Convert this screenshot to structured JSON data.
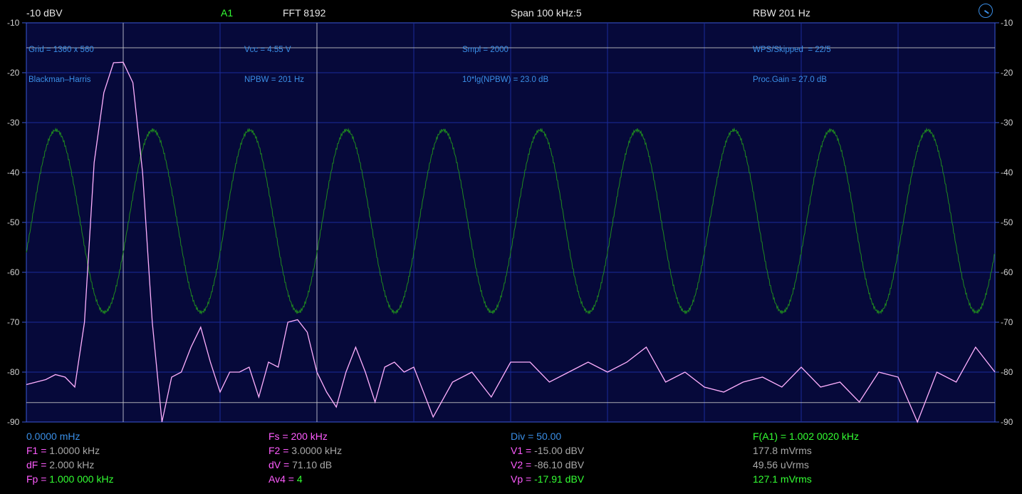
{
  "header": {
    "ref_level": "-10 dBV",
    "channel": "A1",
    "fft": "FFT  8192",
    "span": "Span 100 kHz:5",
    "rbw": "RBW 201 Hz"
  },
  "info": {
    "col1_line1": "Grid = 1360 x 560",
    "col1_line2": "Blackman–Harris",
    "col2_line1": "Vcc = 4.55 V",
    "col2_line2": "NPBW = 201 Hz",
    "col3_line1": "Smpl = 2000",
    "col3_line2": "10*lg(NPBW) = 23.0 dB",
    "col4_line1": "WPS/Skipped  = 22/5",
    "col4_line2": "Proc.Gain = 27.0 dB"
  },
  "y_axis_labels": [
    "-10",
    "-20",
    "-30",
    "-40",
    "-50",
    "-60",
    "-70",
    "-80",
    "-90"
  ],
  "readouts": {
    "start_freq": "0.0000 mHz",
    "fs": "Fs = 200 kHz",
    "div": "Div = 50.00",
    "f_a1": "F(A1) = 1.002 0020 kHz",
    "f1_label": "F1 = ",
    "f1_value": "1.0000 kHz",
    "f2_label": "F2 = ",
    "f2_value": "3.0000 kHz",
    "v1_label": "V1 = ",
    "v1_value": "-15.00 dBV",
    "rms1": "177.8 mVrms",
    "df_label": "dF = ",
    "df_value": "2.000 kHz",
    "dv_label": "dV = ",
    "dv_value": "71.10 dB",
    "v2_label": "V2 = ",
    "v2_value": "-86.10 dBV",
    "rms2": "49.56 uVrms",
    "fp_label": "Fp = ",
    "fp_value": "1.000 000 kHz",
    "av_label": "Av4 = ",
    "av_value": "4",
    "vp_label": "Vp = ",
    "vp_value": "-17.91 dBV",
    "rms3": "127.1 mVrms"
  },
  "colors": {
    "background": "#000000",
    "plot_bg": "#06093a",
    "grid": "#1a2a9a",
    "spectrum": "#ffb0ff",
    "waveform": "#1f8a1f",
    "info_text": "#3a8ee6",
    "cursor": "#c8c8c8"
  },
  "chart_data": {
    "type": "line",
    "ylim": [
      -90,
      -10
    ],
    "y_ticks": [
      -10,
      -20,
      -30,
      -40,
      -50,
      -60,
      -70,
      -80,
      -90
    ],
    "x_range_khz": [
      0,
      10
    ],
    "grid": true,
    "cursors": {
      "f1_khz": 1.0,
      "f2_khz": 3.0,
      "v1_dbv": -15.0,
      "v2_dbv": -86.1
    },
    "series": [
      {
        "kind": "spectrum",
        "x_khz": [
          0,
          0.2,
          0.3,
          0.4,
          0.5,
          0.6,
          0.7,
          0.8,
          0.9,
          1.0,
          1.1,
          1.2,
          1.3,
          1.4,
          1.5,
          1.6,
          1.7,
          1.8,
          1.9,
          2.0,
          2.1,
          2.2,
          2.3,
          2.4,
          2.5,
          2.6,
          2.7,
          2.8,
          2.9,
          3.0,
          3.1,
          3.2,
          3.3,
          3.4,
          3.5,
          3.6,
          3.7,
          3.8,
          3.9,
          4.0,
          4.2,
          4.4,
          4.6,
          4.8,
          5.0,
          5.2,
          5.4,
          5.6,
          5.8,
          6.0,
          6.2,
          6.4,
          6.6,
          6.8,
          7.0,
          7.2,
          7.4,
          7.6,
          7.8,
          8.0,
          8.2,
          8.4,
          8.6,
          8.8,
          9.0,
          9.2,
          9.4,
          9.6,
          9.8,
          10.0
        ],
        "y_dbv": [
          -82.5,
          -81.5,
          -80.5,
          -81,
          -83,
          -70,
          -38,
          -24,
          -18,
          -17.9,
          -22,
          -40,
          -70,
          -90,
          -81,
          -80,
          -75,
          -71,
          -78,
          -84,
          -80,
          -80,
          -79,
          -85,
          -78,
          -79,
          -70,
          -69.5,
          -72,
          -80,
          -84,
          -87,
          -80,
          -75,
          -80,
          -86,
          -79,
          -78,
          -80,
          -79,
          -89,
          -82,
          -80,
          -85,
          -78,
          -78,
          -82,
          -80,
          -78,
          -80,
          -78,
          -75,
          -82,
          -80,
          -83,
          -84,
          -82,
          -81,
          -83,
          -79,
          -83,
          -82,
          -86,
          -80,
          -81,
          -90,
          -80,
          -82,
          -75,
          -80
        ]
      },
      {
        "kind": "waveform",
        "cycles": 10,
        "min_dbv": -68,
        "max_dbv": -31.5
      }
    ]
  }
}
